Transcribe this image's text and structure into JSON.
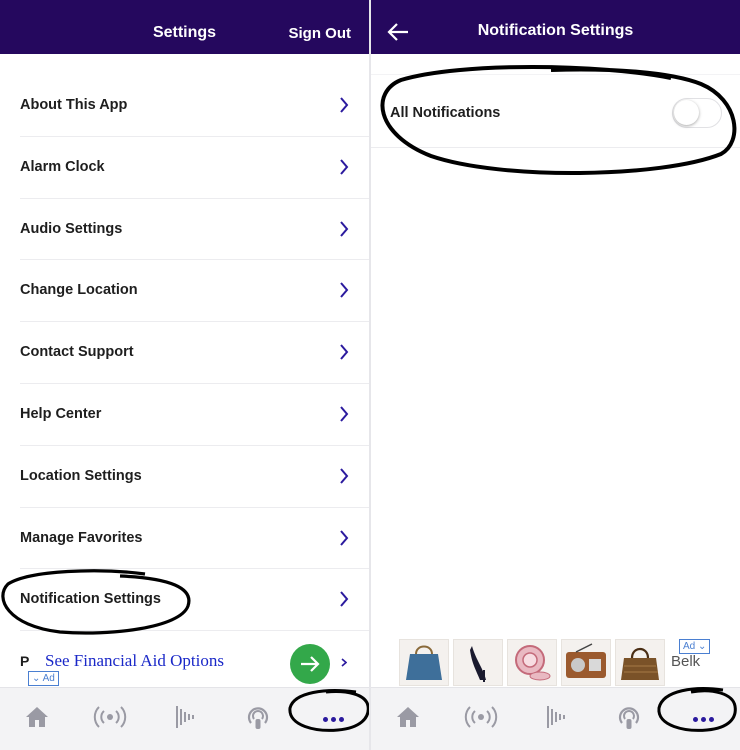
{
  "left_screen": {
    "header": {
      "title": "Settings",
      "sign_out": "Sign Out"
    },
    "items": [
      {
        "label": "About This App"
      },
      {
        "label": "Alarm Clock"
      },
      {
        "label": "Audio Settings"
      },
      {
        "label": "Change Location"
      },
      {
        "label": "Contact Support"
      },
      {
        "label": "Help Center"
      },
      {
        "label": "Location Settings"
      },
      {
        "label": "Manage Favorites"
      },
      {
        "label": "Notification Settings"
      }
    ],
    "partial_item": "P",
    "ad": {
      "text": "See Financial Aid Options",
      "badge": "Ad"
    }
  },
  "right_screen": {
    "header": {
      "title": "Notification Settings"
    },
    "setting": {
      "label": "All Notifications",
      "enabled": false
    },
    "ad": {
      "badge": "Ad",
      "brand": "Belk"
    }
  },
  "bottom_nav": {
    "items": [
      {
        "icon": "home-icon"
      },
      {
        "icon": "radio-broadcast-icon"
      },
      {
        "icon": "audio-waveform-icon"
      },
      {
        "icon": "podcast-icon"
      },
      {
        "icon": "more-dots-icon",
        "active": true
      }
    ]
  },
  "colors": {
    "header_bg": "#25085e",
    "accent": "#2b1a9e",
    "ad_link": "#1a28c8",
    "go_button": "#33a84a"
  }
}
